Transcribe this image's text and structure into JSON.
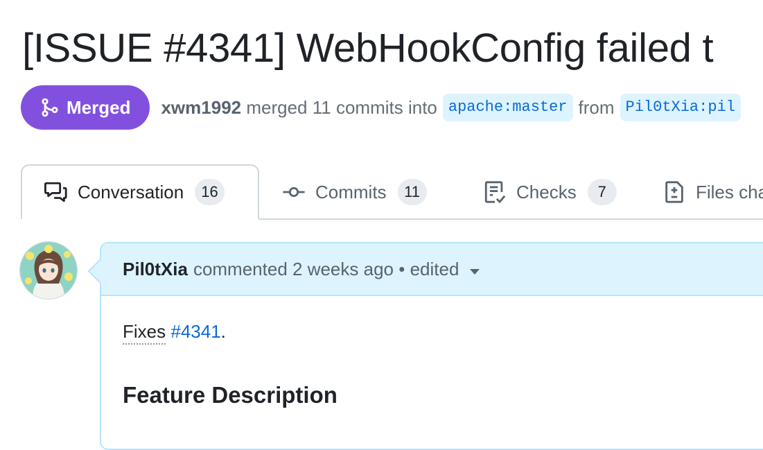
{
  "pr": {
    "title": "[ISSUE #4341] WebHookConfig failed t",
    "status_label": "Merged",
    "author": "xwm1992",
    "merge_text": "merged 11 commits into",
    "base_branch": "apache:master",
    "from_text": "from",
    "head_branch": "Pil0tXia:pil"
  },
  "tabs": [
    {
      "label": "Conversation",
      "count": "16",
      "icon": "comment-discussion-icon"
    },
    {
      "label": "Commits",
      "count": "11",
      "icon": "git-commit-icon"
    },
    {
      "label": "Checks",
      "count": "7",
      "icon": "checklist-icon"
    },
    {
      "label": "Files cha",
      "icon": "file-diff-icon"
    }
  ],
  "comment": {
    "author": "Pil0tXia",
    "action": "commented",
    "time": "2 weeks ago",
    "separator": "•",
    "edited": "edited",
    "fixes_word": "Fixes",
    "issue_ref": "#4341",
    "fixes_end": ".",
    "heading": "Feature Description"
  },
  "colors": {
    "merged": "#8250df",
    "link": "#0969da",
    "comment_header_bg": "#ddf4ff"
  }
}
